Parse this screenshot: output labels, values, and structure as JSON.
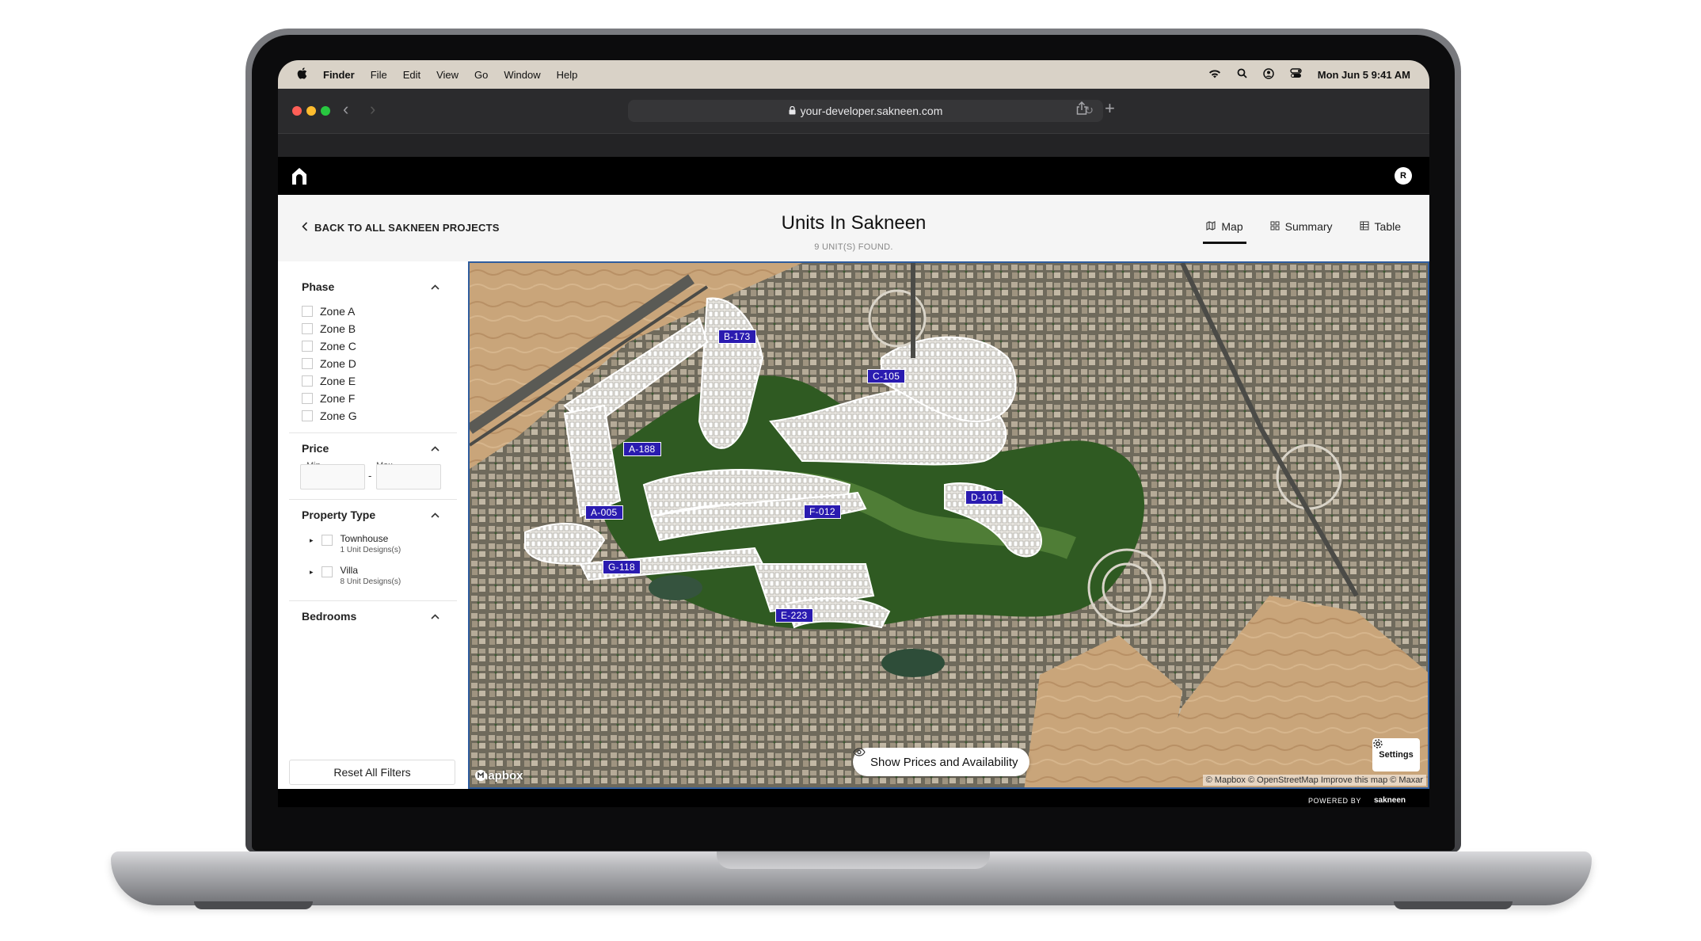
{
  "menubar": {
    "apple_icon": "apple-icon",
    "items": [
      "Finder",
      "File",
      "Edit",
      "View",
      "Go",
      "Window",
      "Help"
    ],
    "status_icons": [
      "wifi-icon",
      "search-icon",
      "user-icon",
      "control-center-icon"
    ],
    "datetime": "Mon Jun 5  9:41 AM"
  },
  "browser": {
    "url": "your-developer.sakneen.com",
    "traffic_lights": [
      "#ff5f57",
      "#febc2e",
      "#28c840"
    ]
  },
  "app": {
    "avatar_initial": "R",
    "back_label": "BACK TO ALL SAKNEEN PROJECTS",
    "title": "Units In Sakneen",
    "subtitle": "9 UNIT(S) FOUND.",
    "view_tabs": [
      {
        "label": "Map",
        "icon": "map-icon",
        "active": true
      },
      {
        "label": "Summary",
        "icon": "grid-icon",
        "active": false
      },
      {
        "label": "Table",
        "icon": "table-icon",
        "active": false
      }
    ]
  },
  "filters": {
    "phase": {
      "title": "Phase",
      "options": [
        "Zone A",
        "Zone B",
        "Zone C",
        "Zone D",
        "Zone E",
        "Zone F",
        "Zone G"
      ]
    },
    "price": {
      "title": "Price",
      "min_label": "Min",
      "max_label": "Max",
      "separator": "-"
    },
    "property_type": {
      "title": "Property Type",
      "options": [
        {
          "name": "Townhouse",
          "sub": "1 Unit Designs(s)"
        },
        {
          "name": "Villa",
          "sub": "8 Unit Designs(s)"
        }
      ]
    },
    "bedrooms": {
      "title": "Bedrooms"
    },
    "reset_label": "Reset All Filters"
  },
  "map": {
    "unit_labels": [
      "B-173",
      "C-105",
      "A-188",
      "D-101",
      "F-012",
      "A-005",
      "G-118",
      "E-223"
    ],
    "show_prices_label": "Show Prices and Availability",
    "settings_label": "Settings",
    "attribution": "© Mapbox © OpenStreetMap  Improve this map  © Maxar",
    "logo_text": "mapbox",
    "label_color": "#2a1bb0"
  },
  "footer": {
    "powered_by": "POWERED BY",
    "brand": "sakneen"
  }
}
